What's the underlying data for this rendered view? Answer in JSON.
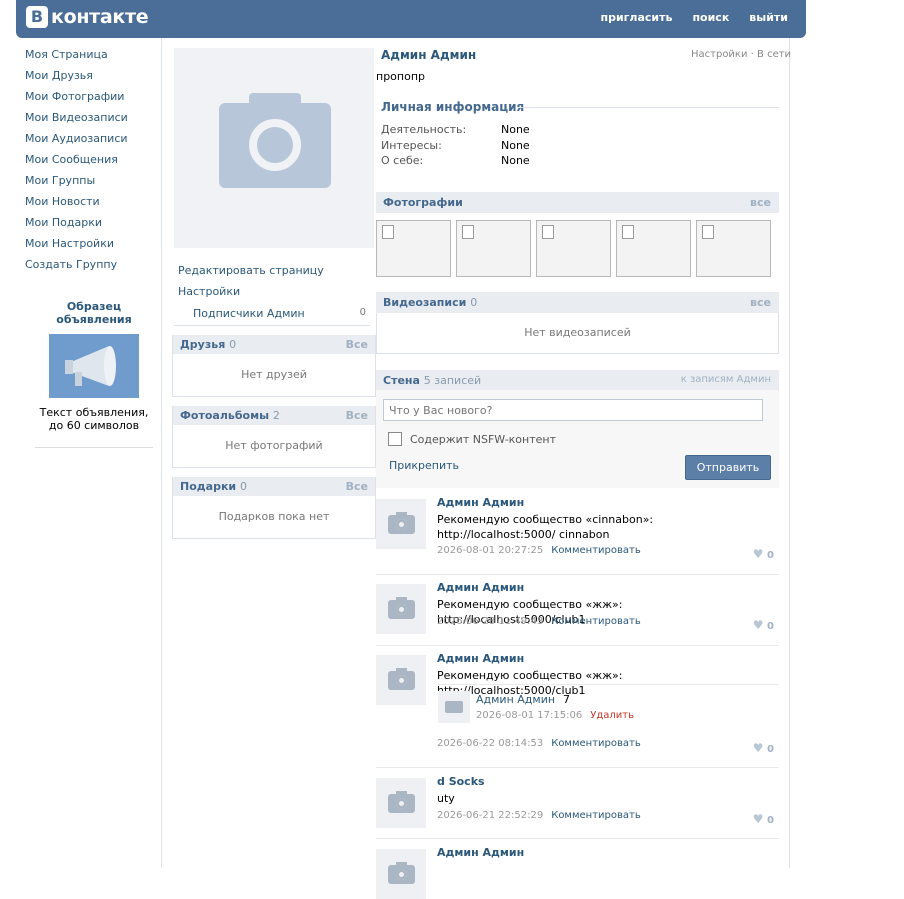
{
  "header": {
    "logo_letter": "B",
    "logo_text": "контакте",
    "nav": [
      "пригласить",
      "поиск",
      "выйти"
    ]
  },
  "left_menu": [
    "Моя Страница",
    "Мои Друзья",
    "Мои Фотографии",
    "Мои Видеозаписи",
    "Мои Аудиозаписи",
    "Мои Сообщения",
    "Мои Группы",
    "Мои Новости",
    "Мои Подарки",
    "Мои Настройки",
    "Создать Группу"
  ],
  "ad": {
    "title": "Образец объявления",
    "text": "Текст объявления, до 60 символов"
  },
  "profile_links": {
    "edit": "Редактировать страницу",
    "settings": "Настройки"
  },
  "subscribers": {
    "label": "Подписчики Админ",
    "count": "0"
  },
  "friends": {
    "title": "Друзья",
    "count": "0",
    "all": "Все",
    "empty": "Нет друзей"
  },
  "albums": {
    "title": "Фотоальбомы",
    "count": "2",
    "all": "Все",
    "empty": "Нет фотографий"
  },
  "gifts": {
    "title": "Подарки",
    "count": "0",
    "all": "Все",
    "empty": "Подарков пока нет"
  },
  "profile": {
    "name": "Админ Админ",
    "settings": "Настройки",
    "dot": "·",
    "online": "В сети",
    "status": "пропопр"
  },
  "personal": {
    "title": "Личная информация",
    "rows": [
      {
        "k": "Деятельность:",
        "v": "None"
      },
      {
        "k": "Интересы:",
        "v": "None"
      },
      {
        "k": "О себе:",
        "v": "None"
      }
    ]
  },
  "photos": {
    "title": "Фотографии",
    "all": "все"
  },
  "videos": {
    "title": "Видеозаписи",
    "count": "0",
    "all": "все",
    "empty": "Нет видеозаписей"
  },
  "wall": {
    "title": "Стена",
    "count": "5 записей",
    "link": "к записям Админ",
    "placeholder": "Что у Вас нового?",
    "nsfw": "Содержит NSFW-контент",
    "attach": "Прикрепить",
    "send": "Отправить"
  },
  "posts": [
    {
      "author": "Админ Админ",
      "text": "Рекомендую сообщество «cinnabon»: http://localhost:5000/ cinnabon",
      "date": "2026-08-01 20:27:25",
      "comment": "Комментировать",
      "likes": "0"
    },
    {
      "author": "Админ Админ",
      "text": "Рекомендую сообщество «жж»: http://localhost:5000/club1",
      "date": "2026-06-28 11:49:43",
      "comment": "Комментировать",
      "likes": "0"
    },
    {
      "author": "Админ Админ",
      "text": "Рекомендую сообщество «жж»: http://localhost:5000/club1",
      "date": "2026-06-22 08:14:53",
      "comment": "Комментировать",
      "likes": "0"
    },
    {
      "author": "d Socks",
      "text": "uty",
      "date": "2026-06-21 22:52:29",
      "comment": "Комментировать",
      "likes": "0"
    },
    {
      "author": "Админ Админ"
    }
  ],
  "reply": {
    "author": "Админ Админ",
    "text": "7",
    "date": "2026-08-01 17:15:06",
    "delete": "Удалить"
  }
}
